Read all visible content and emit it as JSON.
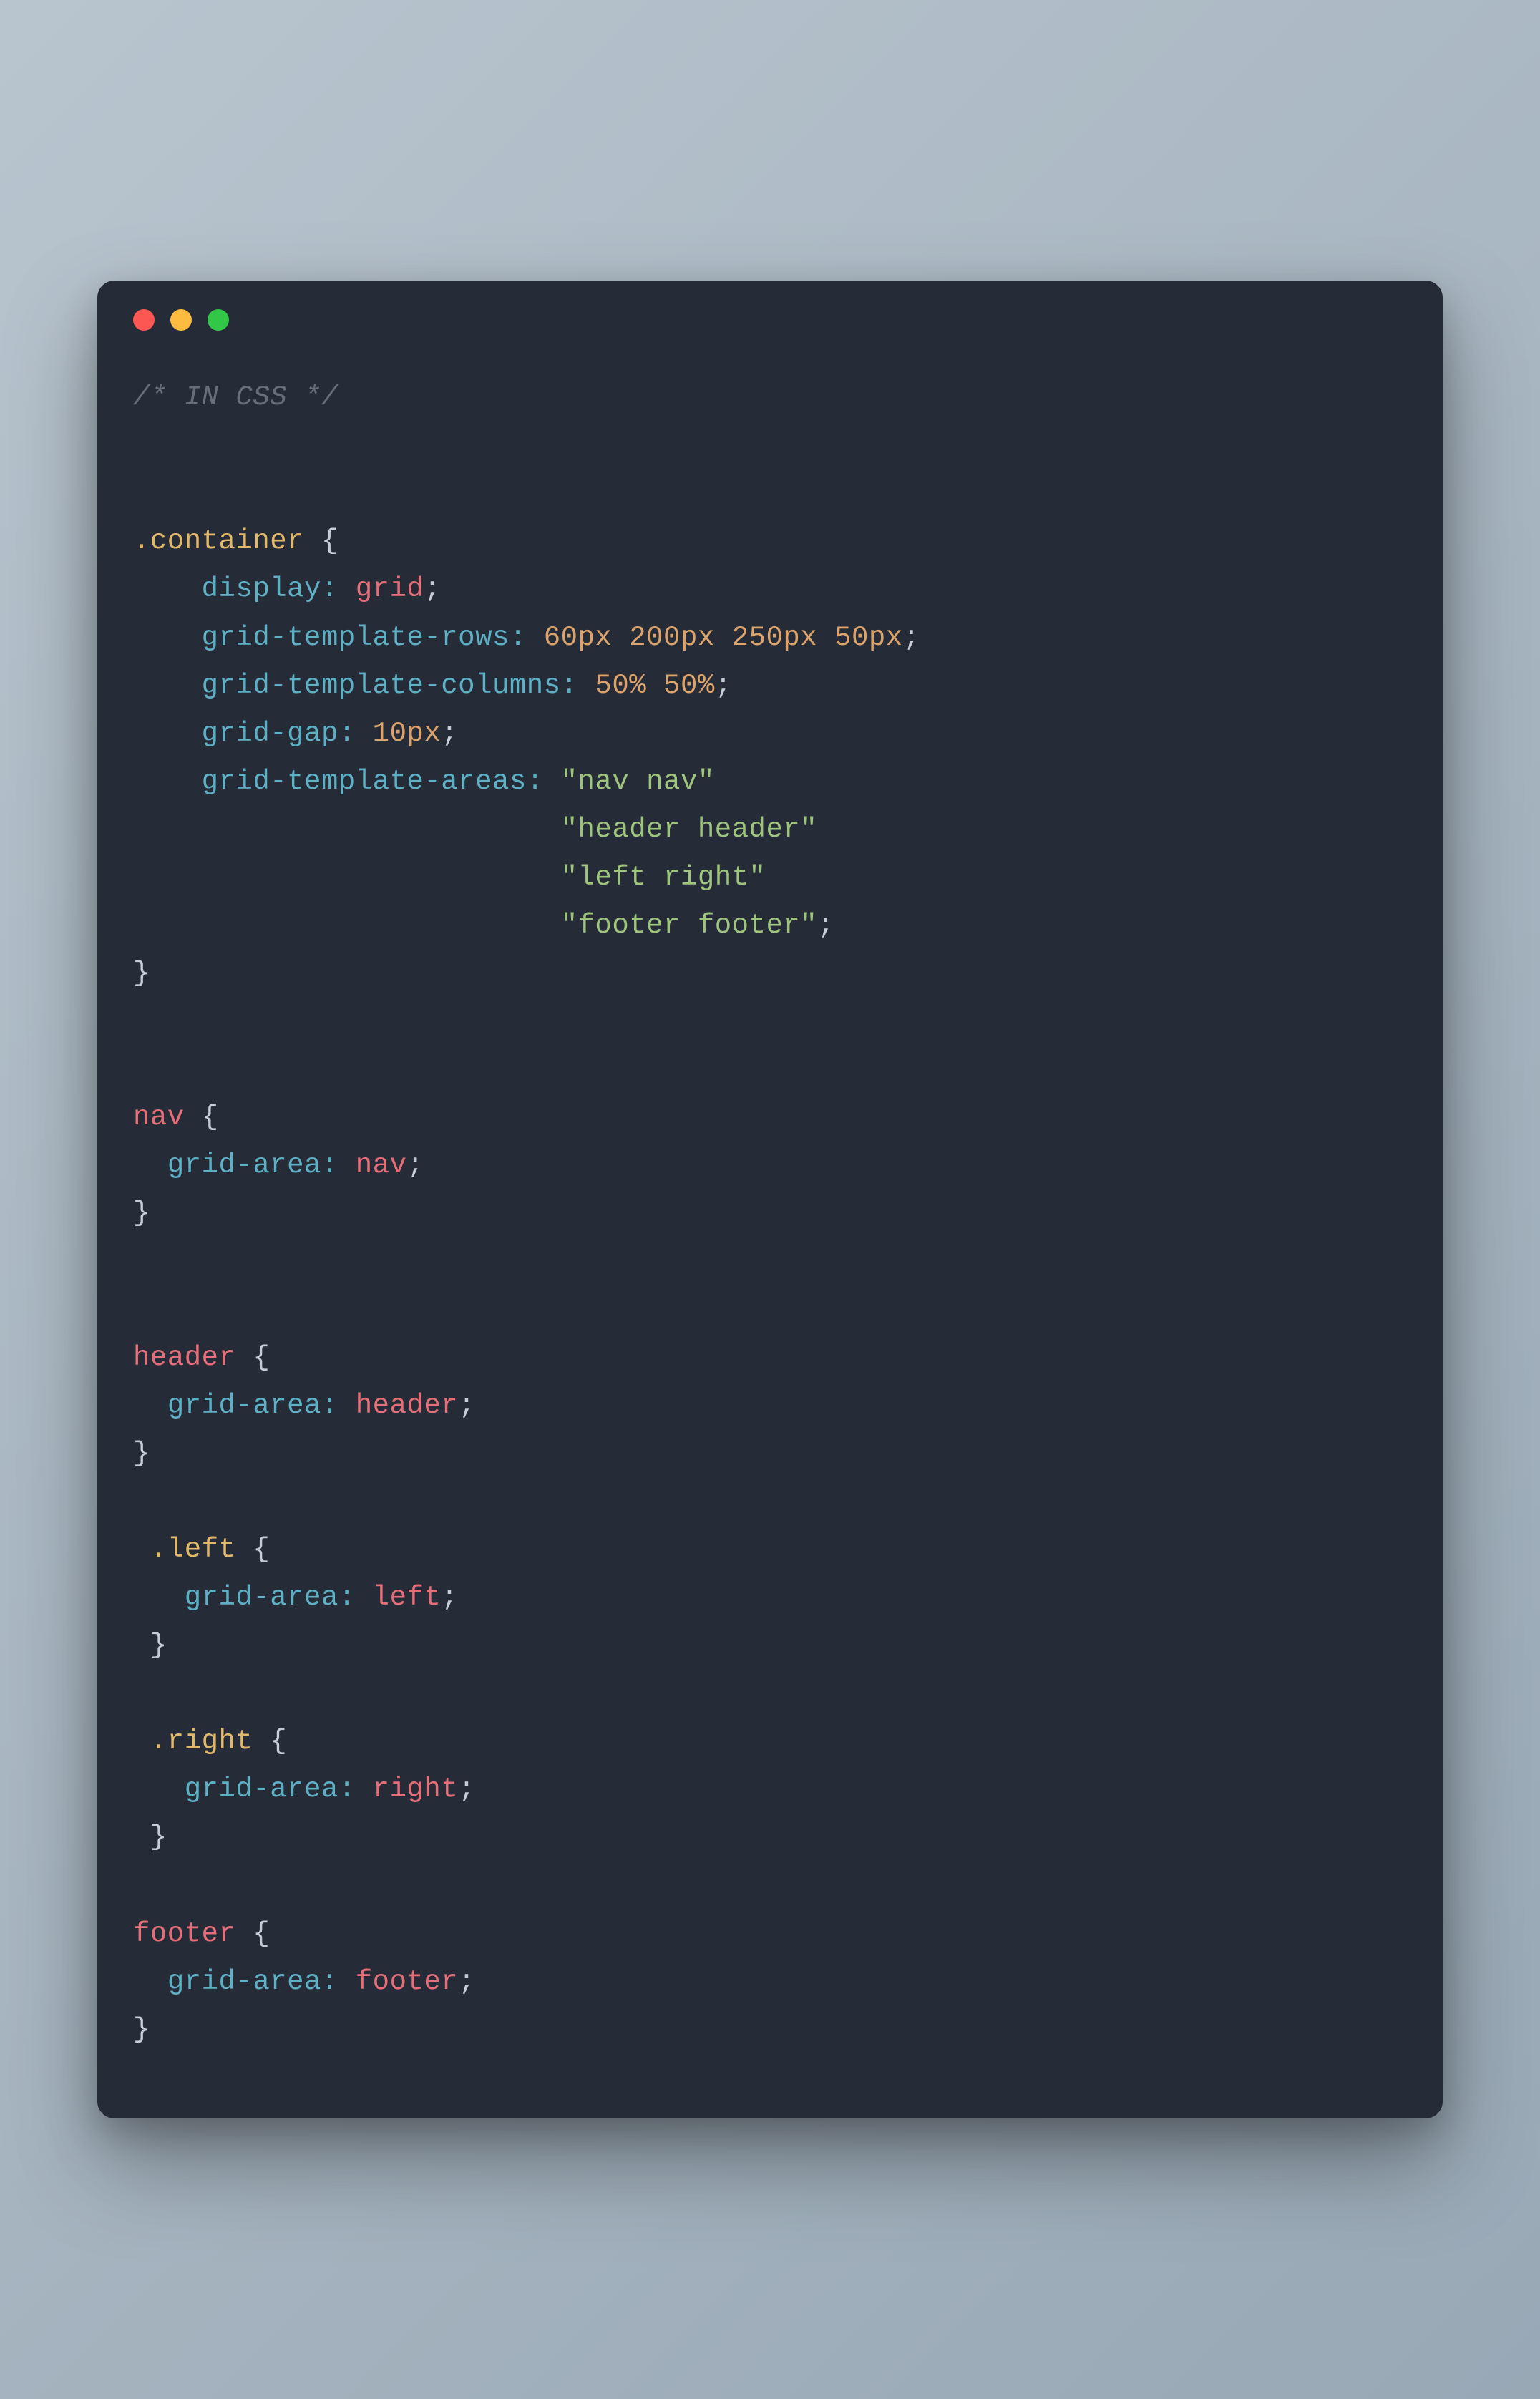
{
  "window": {
    "traffic_lights": [
      "close",
      "minimize",
      "zoom"
    ]
  },
  "code": {
    "comment": "/* IN CSS */",
    "blocks": [
      {
        "selector": ".container",
        "selector_type": "class",
        "props": {
          "display": "grid",
          "grid-template-rows": "60px 200px 250px 50px",
          "grid-template-columns": "50% 50%",
          "grid-gap": "10px",
          "grid-template-areas": {
            "lines": [
              "\"nav nav\"",
              "\"header header\"",
              "\"left right\"",
              "\"footer footer\""
            ]
          }
        }
      },
      {
        "selector": "nav",
        "selector_type": "element",
        "props": {
          "grid-area": "nav"
        }
      },
      {
        "selector": "header",
        "selector_type": "element",
        "props": {
          "grid-area": "header"
        }
      },
      {
        "selector": ".left",
        "selector_type": "class",
        "props": {
          "grid-area": "left"
        }
      },
      {
        "selector": ".right",
        "selector_type": "class",
        "props": {
          "grid-area": "right"
        }
      },
      {
        "selector": "footer",
        "selector_type": "element",
        "props": {
          "grid-area": "footer"
        }
      }
    ]
  },
  "colors": {
    "bg": "#252b37",
    "comment": "#676e78",
    "class_selector": "#e2b86a",
    "element_selector": "#e66e78",
    "property": "#5eb0c4",
    "number": "#dca36a",
    "keyword": "#e66e78",
    "string": "#9ec47e",
    "brace": "#c5cdd8"
  }
}
